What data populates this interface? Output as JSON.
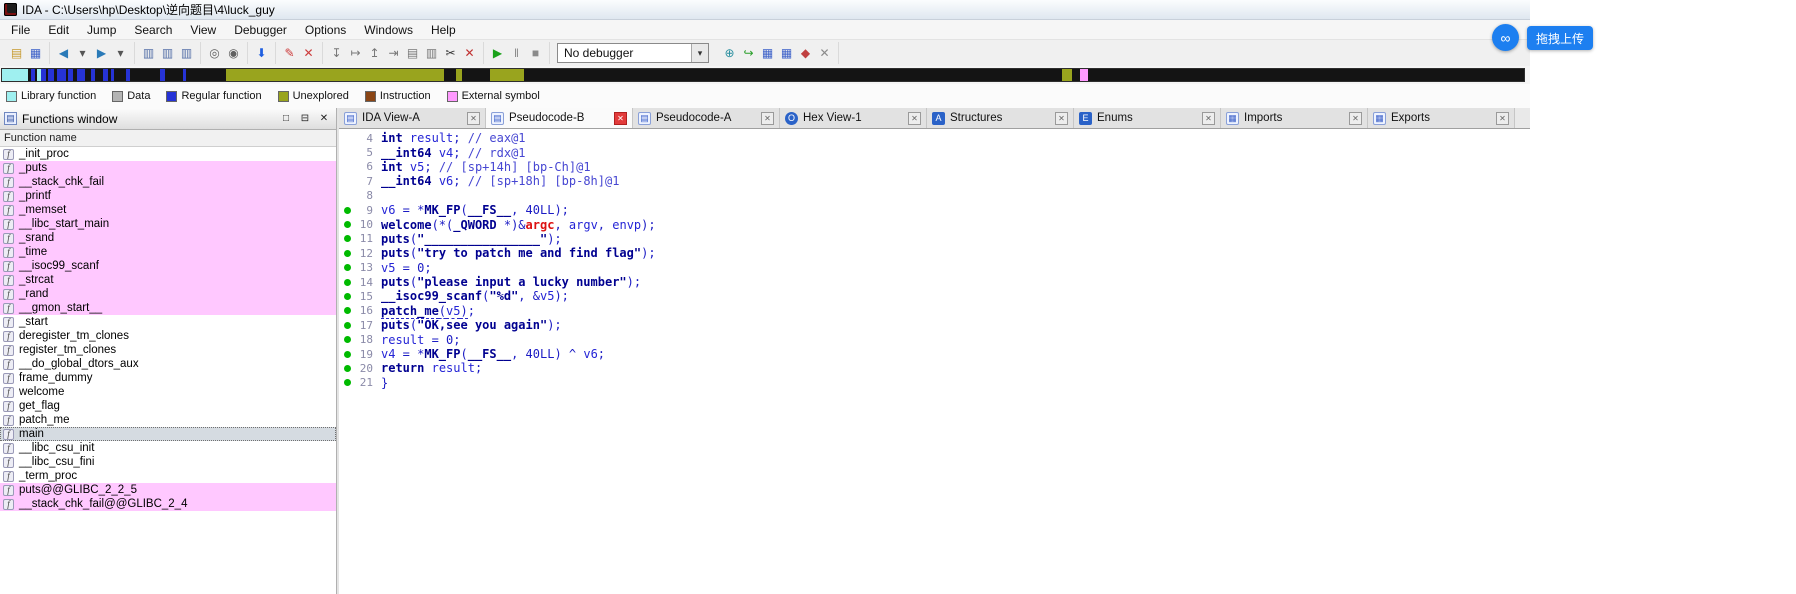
{
  "titlebar": {
    "title": "IDA - C:\\Users\\hp\\Desktop\\逆向题目\\4\\luck_guy"
  },
  "menu": {
    "items": [
      "File",
      "Edit",
      "Jump",
      "Search",
      "View",
      "Debugger",
      "Options",
      "Windows",
      "Help"
    ]
  },
  "ui": {
    "close_glyph": "✕",
    "combo_arrow": "▾",
    "fn_icon_glyph": "f",
    "panel_icon_glyph": "▤",
    "upload_icon_glyph": "∞"
  },
  "colors": {
    "library_row": "#ffc8ff",
    "selected_row": "#d5dbe1",
    "marker_green": "#00ba00",
    "active_close_bg": "#e23b3b",
    "active_close_border": "#b02020"
  },
  "toolbar": {
    "debugger_label": "No debugger",
    "groups_left": [
      {
        "name": "file-group",
        "icons": [
          {
            "n": "open-file-icon",
            "g": "▤",
            "c": "#c79a2e"
          },
          {
            "n": "save-icon",
            "g": "▦",
            "c": "#3a5fc8"
          }
        ]
      },
      {
        "name": "navigate-group",
        "icons": [
          {
            "n": "back-icon",
            "g": "◀",
            "c": "#2a7ab8"
          },
          {
            "n": "back-history-icon",
            "g": "▾",
            "c": "#555555"
          },
          {
            "n": "forward-icon",
            "g": "▶",
            "c": "#2a7ab8"
          },
          {
            "n": "forward-history-icon",
            "g": "▾",
            "c": "#555555"
          }
        ]
      },
      {
        "name": "jump-group",
        "icons": [
          {
            "n": "jump-function-icon",
            "g": "▥",
            "c": "#5570a8"
          },
          {
            "n": "jump-name-icon",
            "g": "▥",
            "c": "#5570a8"
          },
          {
            "n": "jump-address-icon",
            "g": "▥",
            "c": "#5570a8"
          }
        ]
      },
      {
        "name": "search-group",
        "icons": [
          {
            "n": "search-text-icon",
            "g": "◎",
            "c": "#606060"
          },
          {
            "n": "search-bytes-icon",
            "g": "◉",
            "c": "#606060"
          }
        ]
      },
      {
        "name": "jump-next-group",
        "icons": [
          {
            "n": "jump-next-icon",
            "g": "⬇",
            "c": "#1f5fe0"
          }
        ]
      },
      {
        "name": "patch-group",
        "icons": [
          {
            "n": "patch-program-icon",
            "g": "✎",
            "c": "#cc3b3b"
          },
          {
            "n": "discard-icon",
            "g": "✕",
            "c": "#cc3b3b"
          }
        ]
      },
      {
        "name": "debug-tools-group",
        "icons": [
          {
            "n": "step-into-icon",
            "g": "↧",
            "c": "#777777"
          },
          {
            "n": "step-over-icon",
            "g": "↦",
            "c": "#777777"
          },
          {
            "n": "run-until-return-icon",
            "g": "↥",
            "c": "#777777"
          },
          {
            "n": "run-to-cursor-icon",
            "g": "⇥",
            "c": "#777777"
          },
          {
            "n": "stack-trace-icon",
            "g": "▤",
            "c": "#777777"
          },
          {
            "n": "watch-list-icon",
            "g": "▥",
            "c": "#777777"
          },
          {
            "n": "cut-icon",
            "g": "✂",
            "c": "#333333"
          },
          {
            "n": "cancel-action-icon",
            "g": "✕",
            "c": "#c03030"
          }
        ]
      },
      {
        "name": "run-group",
        "icons": [
          {
            "n": "start-process-icon",
            "g": "▶",
            "c": "#1aa21a"
          },
          {
            "n": "pause-process-icon",
            "g": "‖",
            "c": "#8a8a8a"
          },
          {
            "n": "stop-process-icon",
            "g": "■",
            "c": "#8a8a8a"
          }
        ]
      }
    ],
    "groups_right": [
      {
        "name": "debugger-windows-group",
        "icons": [
          {
            "n": "attach-icon",
            "g": "⊕",
            "c": "#2a8f9f"
          },
          {
            "n": "trace-icon",
            "g": "↪",
            "c": "#2a9f2a"
          },
          {
            "n": "segments-icon",
            "g": "▦",
            "c": "#3a5fc8"
          },
          {
            "n": "modules-icon",
            "g": "▦",
            "c": "#3a5fc8"
          },
          {
            "n": "breakpoints-icon",
            "g": "◆",
            "c": "#c04040"
          },
          {
            "n": "close-tool-icon",
            "g": "✕",
            "c": "#8a8a8a"
          }
        ]
      }
    ]
  },
  "navband": {
    "segments": [
      [
        "#9ff0f0",
        26
      ],
      [
        "#141414",
        3
      ],
      [
        "#2633d6",
        4
      ],
      [
        "#141414",
        2
      ],
      [
        "#9ff0f0",
        4
      ],
      [
        "#2633d6",
        5
      ],
      [
        "#141414",
        2
      ],
      [
        "#2633d6",
        6
      ],
      [
        "#141414",
        3
      ],
      [
        "#2633d6",
        9
      ],
      [
        "#141414",
        2
      ],
      [
        "#2633d6",
        5
      ],
      [
        "#141414",
        4
      ],
      [
        "#2633d6",
        8
      ],
      [
        "#141414",
        6
      ],
      [
        "#2633d6",
        4
      ],
      [
        "#141414",
        8
      ],
      [
        "#2633d6",
        5
      ],
      [
        "#141414",
        3
      ],
      [
        "#2633d6",
        3
      ],
      [
        "#141414",
        12
      ],
      [
        "#2633d6",
        4
      ],
      [
        "#141414",
        30
      ],
      [
        "#2633d6",
        5
      ],
      [
        "#141414",
        18
      ],
      [
        "#2633d6",
        3
      ],
      [
        "#141414",
        40
      ],
      [
        "#99a41e",
        218
      ],
      [
        "#141414",
        12
      ],
      [
        "#99a41e",
        6
      ],
      [
        "#141414",
        28
      ],
      [
        "#99a41e",
        34
      ],
      [
        "#141414",
        538
      ],
      [
        "#99a41e",
        10
      ],
      [
        "#141414",
        8
      ],
      [
        "#ff9aff",
        8
      ],
      [
        "#141414",
        441
      ]
    ]
  },
  "legend": {
    "items": [
      {
        "label": "Library function",
        "color": "#9ff0f0"
      },
      {
        "label": "Data",
        "color": "#b4b4b4"
      },
      {
        "label": "Regular function",
        "color": "#2633d6"
      },
      {
        "label": "Unexplored",
        "color": "#99a41e"
      },
      {
        "label": "Instruction",
        "color": "#8a4515"
      },
      {
        "label": "External symbol",
        "color": "#ff9aff"
      }
    ]
  },
  "functions": {
    "title": "Functions window",
    "column_header": "Function name",
    "header_buttons": [
      {
        "n": "maximize-button",
        "g": "□"
      },
      {
        "n": "undock-button",
        "g": "⊟"
      },
      {
        "n": "close-panel-button",
        "g": "✕"
      }
    ],
    "rows": [
      {
        "name": "_init_proc",
        "type": "regular",
        "selected": false
      },
      {
        "name": "_puts",
        "type": "library",
        "selected": false
      },
      {
        "name": "__stack_chk_fail",
        "type": "library",
        "selected": false
      },
      {
        "name": "_printf",
        "type": "library",
        "selected": false
      },
      {
        "name": "_memset",
        "type": "library",
        "selected": false
      },
      {
        "name": "__libc_start_main",
        "type": "library",
        "selected": false
      },
      {
        "name": "_srand",
        "type": "library",
        "selected": false
      },
      {
        "name": "_time",
        "type": "library",
        "selected": false
      },
      {
        "name": "__isoc99_scanf",
        "type": "library",
        "selected": false
      },
      {
        "name": "_strcat",
        "type": "library",
        "selected": false
      },
      {
        "name": "_rand",
        "type": "library",
        "selected": false
      },
      {
        "name": "__gmon_start__",
        "type": "library",
        "selected": false
      },
      {
        "name": "_start",
        "type": "regular",
        "selected": false
      },
      {
        "name": "deregister_tm_clones",
        "type": "regular",
        "selected": false
      },
      {
        "name": "register_tm_clones",
        "type": "regular",
        "selected": false
      },
      {
        "name": "__do_global_dtors_aux",
        "type": "regular",
        "selected": false
      },
      {
        "name": "frame_dummy",
        "type": "regular",
        "selected": false
      },
      {
        "name": "welcome",
        "type": "regular",
        "selected": false
      },
      {
        "name": "get_flag",
        "type": "regular",
        "selected": false
      },
      {
        "name": "patch_me",
        "type": "regular",
        "selected": false
      },
      {
        "name": "main",
        "type": "regular",
        "selected": true
      },
      {
        "name": "__libc_csu_init",
        "type": "regular",
        "selected": false
      },
      {
        "name": "__libc_csu_fini",
        "type": "regular",
        "selected": false
      },
      {
        "name": "_term_proc",
        "type": "regular",
        "selected": false
      },
      {
        "name": "puts@@GLIBC_2_2_5",
        "type": "library",
        "selected": false
      },
      {
        "name": "__stack_chk_fail@@GLIBC_2_4",
        "type": "library",
        "selected": false
      }
    ]
  },
  "tabs": [
    {
      "label": "IDA View-A",
      "active": false,
      "icon_name": "ida-view-icon",
      "icon": {
        "g": "▤",
        "bg": "#eef3ff",
        "fg": "#3a5fc8",
        "border": "#8aa0d8",
        "round": false
      }
    },
    {
      "label": "Pseudocode-B",
      "active": true,
      "icon_name": "pseudocode-icon",
      "icon": {
        "g": "▤",
        "bg": "#eef3ff",
        "fg": "#3a5fc8",
        "border": "#8aa0d8",
        "round": false
      }
    },
    {
      "label": "Pseudocode-A",
      "active": false,
      "icon_name": "pseudocode-icon",
      "icon": {
        "g": "▤",
        "bg": "#eef3ff",
        "fg": "#3a5fc8",
        "border": "#8aa0d8",
        "round": false
      }
    },
    {
      "label": "Hex View-1",
      "active": false,
      "icon_name": "hex-view-icon",
      "icon": {
        "g": "O",
        "bg": "#2a62c8",
        "fg": "#ffffff",
        "border": "",
        "round": true
      }
    },
    {
      "label": "Structures",
      "active": false,
      "icon_name": "structures-icon",
      "icon": {
        "g": "A",
        "bg": "#2a62c8",
        "fg": "#ffffff",
        "border": "",
        "round": false
      }
    },
    {
      "label": "Enums",
      "active": false,
      "icon_name": "enums-icon",
      "icon": {
        "g": "E",
        "bg": "#2a62c8",
        "fg": "#ffffff",
        "border": "",
        "round": false
      }
    },
    {
      "label": "Imports",
      "active": false,
      "icon_name": "imports-icon",
      "icon": {
        "g": "▦",
        "bg": "#eef3ff",
        "fg": "#3a5fc8",
        "border": "#8aa0d8",
        "round": false
      }
    },
    {
      "label": "Exports",
      "active": false,
      "icon_name": "exports-icon",
      "icon": {
        "g": "▦",
        "bg": "#eef3ff",
        "fg": "#3a5fc8",
        "border": "#8aa0d8",
        "round": false
      }
    }
  ],
  "code": {
    "lines": [
      {
        "n": "4",
        "dot": false,
        "seg": [
          [
            "k",
            "int"
          ],
          [
            "p",
            " "
          ],
          [
            "v",
            "result"
          ],
          [
            "p",
            "; "
          ],
          [
            "c",
            "// eax@1"
          ]
        ]
      },
      {
        "n": "5",
        "dot": false,
        "seg": [
          [
            "k",
            "__int64"
          ],
          [
            "p",
            " "
          ],
          [
            "v",
            "v4"
          ],
          [
            "p",
            "; "
          ],
          [
            "c",
            "// rdx@1"
          ]
        ]
      },
      {
        "n": "6",
        "dot": false,
        "seg": [
          [
            "k",
            "int"
          ],
          [
            "p",
            " "
          ],
          [
            "v",
            "v5"
          ],
          [
            "p",
            "; "
          ],
          [
            "c",
            "// [sp+14h] [bp-Ch]@1"
          ]
        ]
      },
      {
        "n": "7",
        "dot": false,
        "seg": [
          [
            "k",
            "__int64"
          ],
          [
            "p",
            " "
          ],
          [
            "v",
            "v6"
          ],
          [
            "p",
            "; "
          ],
          [
            "c",
            "// [sp+18h] [bp-8h]@1"
          ]
        ]
      },
      {
        "n": "8",
        "dot": false,
        "seg": []
      },
      {
        "n": "9",
        "dot": true,
        "seg": [
          [
            "v",
            "v6"
          ],
          [
            "p",
            " = *"
          ],
          [
            "f",
            "MK_FP"
          ],
          [
            "p",
            "("
          ],
          [
            "k",
            "__FS__"
          ],
          [
            "p",
            ", "
          ],
          [
            "m",
            "40LL"
          ],
          [
            "p",
            ");"
          ]
        ]
      },
      {
        "n": "10",
        "dot": true,
        "seg": [
          [
            "f",
            "welcome"
          ],
          [
            "p",
            "(*("
          ],
          [
            "k",
            "_QWORD"
          ],
          [
            "p",
            " *)&"
          ],
          [
            "r",
            "argc"
          ],
          [
            "p",
            ", "
          ],
          [
            "v",
            "argv"
          ],
          [
            "p",
            ", "
          ],
          [
            "v",
            "envp"
          ],
          [
            "p",
            ");"
          ]
        ]
      },
      {
        "n": "11",
        "dot": true,
        "seg": [
          [
            "f",
            "puts"
          ],
          [
            "p",
            "("
          ],
          [
            "s",
            "\"________________\""
          ],
          [
            "p",
            ");"
          ]
        ]
      },
      {
        "n": "12",
        "dot": true,
        "seg": [
          [
            "f",
            "puts"
          ],
          [
            "p",
            "("
          ],
          [
            "s",
            "\"try to patch me and find flag\""
          ],
          [
            "p",
            ");"
          ]
        ]
      },
      {
        "n": "13",
        "dot": true,
        "seg": [
          [
            "v",
            "v5"
          ],
          [
            "p",
            " = "
          ],
          [
            "m",
            "0"
          ],
          [
            "p",
            ";"
          ]
        ]
      },
      {
        "n": "14",
        "dot": true,
        "seg": [
          [
            "f",
            "puts"
          ],
          [
            "p",
            "("
          ],
          [
            "s",
            "\"please input a lucky number\""
          ],
          [
            "p",
            ");"
          ]
        ]
      },
      {
        "n": "15",
        "dot": true,
        "seg": [
          [
            "f",
            "__isoc99_scanf"
          ],
          [
            "p",
            "("
          ],
          [
            "s",
            "\"%d\""
          ],
          [
            "p",
            ", &"
          ],
          [
            "v",
            "v5"
          ],
          [
            "p",
            ");"
          ]
        ]
      },
      {
        "n": "16",
        "dot": true,
        "seg": [
          [
            "f u",
            "patch_me"
          ],
          [
            "p u",
            "("
          ],
          [
            "v u",
            "v5"
          ],
          [
            "p u",
            ")"
          ],
          [
            "p",
            ";"
          ]
        ]
      },
      {
        "n": "17",
        "dot": true,
        "seg": [
          [
            "f",
            "puts"
          ],
          [
            "p",
            "("
          ],
          [
            "s",
            "\"OK,see you again\""
          ],
          [
            "p",
            ");"
          ]
        ]
      },
      {
        "n": "18",
        "dot": true,
        "seg": [
          [
            "v",
            "result"
          ],
          [
            "p",
            " = "
          ],
          [
            "m",
            "0"
          ],
          [
            "p",
            ";"
          ]
        ]
      },
      {
        "n": "19",
        "dot": true,
        "seg": [
          [
            "v",
            "v4"
          ],
          [
            "p",
            " = *"
          ],
          [
            "f",
            "MK_FP"
          ],
          [
            "p",
            "("
          ],
          [
            "k",
            "__FS__"
          ],
          [
            "p",
            ", "
          ],
          [
            "m",
            "40LL"
          ],
          [
            "p",
            ") ^ "
          ],
          [
            "v",
            "v6"
          ],
          [
            "p",
            ";"
          ]
        ]
      },
      {
        "n": "20",
        "dot": true,
        "seg": [
          [
            "k",
            "return"
          ],
          [
            "p",
            " "
          ],
          [
            "v",
            "result"
          ],
          [
            "p",
            ";"
          ]
        ]
      },
      {
        "n": "21",
        "dot": true,
        "seg": [
          [
            "p",
            "}"
          ]
        ]
      }
    ]
  },
  "overlay": {
    "upload_label": "拖拽上传"
  }
}
